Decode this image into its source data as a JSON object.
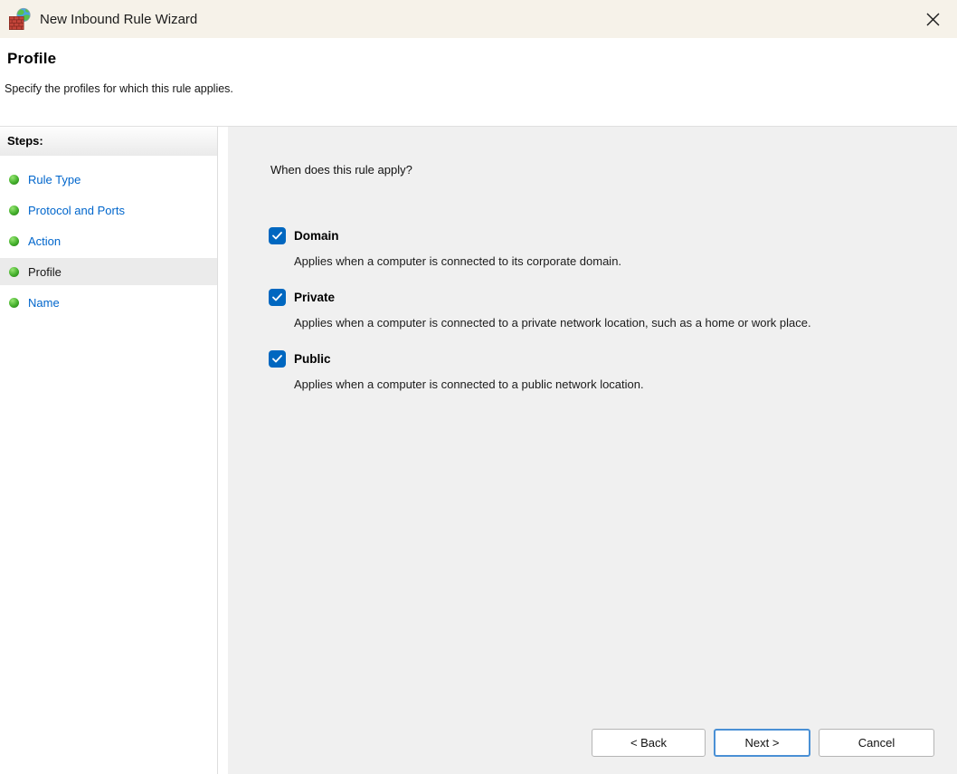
{
  "window": {
    "title": "New Inbound Rule Wizard"
  },
  "header": {
    "title": "Profile",
    "subtitle": "Specify the profiles for which this rule applies."
  },
  "sidebar": {
    "heading": "Steps:",
    "items": [
      {
        "label": "Rule Type",
        "active": false
      },
      {
        "label": "Protocol and Ports",
        "active": false
      },
      {
        "label": "Action",
        "active": false
      },
      {
        "label": "Profile",
        "active": true
      },
      {
        "label": "Name",
        "active": false
      }
    ]
  },
  "main": {
    "question": "When does this rule apply?",
    "profiles": [
      {
        "label": "Domain",
        "checked": true,
        "description": "Applies when a computer is connected to its corporate domain."
      },
      {
        "label": "Private",
        "checked": true,
        "description": "Applies when a computer is connected to a private network location, such as a home or work place."
      },
      {
        "label": "Public",
        "checked": true,
        "description": "Applies when a computer is connected to a public network location."
      }
    ]
  },
  "buttons": {
    "back": "< Back",
    "next": "Next >",
    "cancel": "Cancel"
  },
  "colors": {
    "titlebar_bg": "#f6f2e9",
    "panel_bg": "#f0f0f0",
    "active_step_bg": "#ebebeb",
    "link_blue": "#0066cc",
    "checkbox_blue": "#0067c0",
    "next_button_border": "#4a90d5",
    "bullet_green": "#44b02c"
  }
}
